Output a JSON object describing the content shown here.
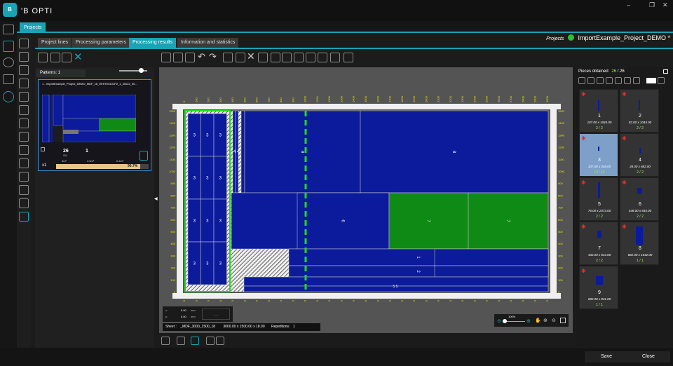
{
  "app": {
    "logo": "B",
    "title": "'B OPTI",
    "window_controls": [
      "–",
      "❐",
      "✕"
    ]
  },
  "ribbon": {
    "projects_tab": "Projects"
  },
  "project": {
    "label": "Projects",
    "name": "ImportExample_Project_DEMO *",
    "status_color": "#2fbf3a"
  },
  "tabs": [
    {
      "label": "Project lines"
    },
    {
      "label": "Processing parameters"
    },
    {
      "label": "Processing results"
    },
    {
      "label": "Information and statistics"
    }
  ],
  "patterns_panel": {
    "header": "Patterns: 1",
    "card": {
      "title": "1 - ImportExample_Project_DEMO_MDF_18_WHITE6101P2_1_45x22_00...",
      "pieces_count": "26",
      "pieces_total": "/26",
      "patterns": "1",
      "area_used": "4m²",
      "area_waste": "4.5m²",
      "area_other": "0.4m²",
      "multiplier": "x1",
      "percent": "90.7%",
      "percent_value": 90.7
    }
  },
  "canvas": {
    "x_ticks": [
      "0",
      "100",
      "200",
      "300",
      "400",
      "500",
      "600",
      "700",
      "800",
      "900",
      "1000",
      "1100",
      "1200",
      "1300",
      "1400",
      "1500",
      "1600",
      "1700",
      "1800",
      "1900",
      "2000",
      "2100",
      "2200",
      "2300",
      "2400",
      "2500",
      "2600",
      "2700",
      "2800",
      "2900",
      "3000"
    ],
    "y_ticks": [
      "1500",
      "1400",
      "1300",
      "1200",
      "1100",
      "1000",
      "900",
      "800",
      "700",
      "600",
      "500",
      "400",
      "300",
      "200",
      "100",
      "0"
    ],
    "piece_labels": {
      "three": "3",
      "eight": "8",
      "nine": "9",
      "four": "4",
      "four_four": "4 4",
      "six": "6",
      "seven": "7",
      "one": "1",
      "two": "2",
      "five": "5",
      "five_five": "5 5"
    },
    "colors": {
      "piece": "#0b1b9c",
      "selected": "#0f8a14",
      "cut": "#1bdc1b",
      "border": "#d0d0d0"
    }
  },
  "coords": {
    "x_label": "x:",
    "x_value": "0.00",
    "x_unit": "mm",
    "y_label": "y:",
    "y_value": "0.00",
    "y_unit": "mm",
    "extra": "- - -"
  },
  "zoom": {
    "value": "100%"
  },
  "sheet_info": {
    "label": "Sheet :",
    "sheet": "_MDF_3000_1500_18",
    "dims": "3000.00 x 1500.00 x 18.00",
    "rep_label": "Repetitions:",
    "rep": "1"
  },
  "pieces_panel": {
    "header": "Pieces obtained",
    "obtained": "26",
    "total": "26",
    "items": [
      {
        "num": "1",
        "dims": "107.00 x 1044.00",
        "count": "2 / 2"
      },
      {
        "num": "2",
        "dims": "82.00 x 1044.00",
        "count": "2 / 2"
      },
      {
        "num": "3",
        "dims": "107.00 x 346.00",
        "count": "12 / 12"
      },
      {
        "num": "4",
        "dims": "28.00 x 682.00",
        "count": "2 / 2"
      },
      {
        "num": "5",
        "dims": "76.00 x 2473.00",
        "count": "2 / 2"
      },
      {
        "num": "6",
        "dims": "446.00 x 644.00",
        "count": "2 / 2"
      },
      {
        "num": "7",
        "dims": "442.00 x 644.00",
        "count": "2 / 2"
      },
      {
        "num": "8",
        "dims": "682.00 x 1642.00",
        "count": "1 / 1"
      },
      {
        "num": "9",
        "dims": "682.00 x 831.00",
        "count": "1 / 1"
      }
    ]
  },
  "footer": {
    "save": "Save",
    "close": "Close"
  }
}
